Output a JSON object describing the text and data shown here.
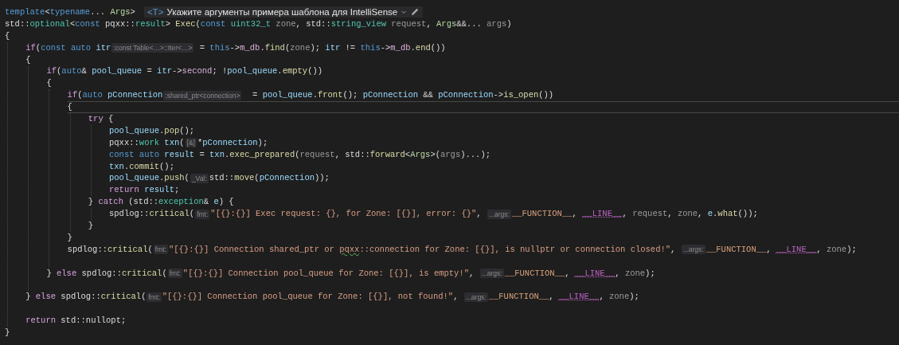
{
  "editor": {
    "lines": [
      {
        "kind": "code",
        "tokens": [
          {
            "text": "template",
            "kind": "kw"
          },
          {
            "text": "<",
            "kind": "pl"
          },
          {
            "text": "typename",
            "kind": "kw"
          },
          {
            "text": "... ",
            "kind": "pl"
          },
          {
            "text": "Args",
            "kind": "tp"
          },
          {
            "text": ">",
            "kind": "pl"
          }
        ],
        "hint_bar": {
          "badge": "<T>",
          "text": "Укажите аргументы примера шаблона для IntelliSense"
        }
      },
      {
        "kind": "code",
        "tokens": [
          {
            "text": "std::",
            "kind": "pl"
          },
          {
            "text": "optional",
            "kind": "type"
          },
          {
            "text": "<",
            "kind": "pl"
          },
          {
            "text": "const",
            "kind": "kw"
          },
          {
            "text": " pqxx::",
            "kind": "pl"
          },
          {
            "text": "result",
            "kind": "type"
          },
          {
            "text": "> ",
            "kind": "pl"
          },
          {
            "text": "Exec",
            "kind": "fn"
          },
          {
            "text": "(",
            "kind": "pl"
          },
          {
            "text": "const ",
            "kind": "kw"
          },
          {
            "text": "uint32_t ",
            "kind": "type"
          },
          {
            "text": "zone",
            "kind": "prm"
          },
          {
            "text": ", std::",
            "kind": "pl"
          },
          {
            "text": "string_view ",
            "kind": "type"
          },
          {
            "text": "request",
            "kind": "prm"
          },
          {
            "text": ", ",
            "kind": "pl"
          },
          {
            "text": "Args",
            "kind": "tp"
          },
          {
            "text": "&&... ",
            "kind": "pl"
          },
          {
            "text": "args",
            "kind": "prm"
          },
          {
            "text": ")",
            "kind": "pl"
          }
        ]
      },
      {
        "kind": "code",
        "tokens": [
          {
            "text": "{",
            "kind": "pl"
          }
        ],
        "children": [
          {
            "kind": "code",
            "tokens": [
              {
                "text": "if",
                "kind": "ctl"
              },
              {
                "text": "(",
                "kind": "pl"
              },
              {
                "text": "const ",
                "kind": "kw"
              },
              {
                "text": "auto ",
                "kind": "kw"
              },
              {
                "text": "itr",
                "kind": "var"
              },
              {
                "text": ":const Table<…>::Iter<…>",
                "kind": "hint"
              },
              {
                "text": " = ",
                "kind": "pl"
              },
              {
                "text": "this",
                "kind": "kw"
              },
              {
                "text": "->",
                "kind": "pl"
              },
              {
                "text": "m_db",
                "kind": "mem"
              },
              {
                "text": ".",
                "kind": "pl"
              },
              {
                "text": "find",
                "kind": "fn"
              },
              {
                "text": "(",
                "kind": "pl"
              },
              {
                "text": "zone",
                "kind": "prm"
              },
              {
                "text": "); ",
                "kind": "pl"
              },
              {
                "text": "itr",
                "kind": "var"
              },
              {
                "text": " != ",
                "kind": "pl"
              },
              {
                "text": "this",
                "kind": "kw"
              },
              {
                "text": "->",
                "kind": "pl"
              },
              {
                "text": "m_db",
                "kind": "mem"
              },
              {
                "text": ".",
                "kind": "pl"
              },
              {
                "text": "end",
                "kind": "fn"
              },
              {
                "text": "())",
                "kind": "pl"
              }
            ]
          },
          {
            "kind": "code",
            "tokens": [
              {
                "text": "{",
                "kind": "pl"
              }
            ],
            "children": [
              {
                "kind": "code",
                "tokens": [
                  {
                    "text": "if",
                    "kind": "ctl"
                  },
                  {
                    "text": "(",
                    "kind": "pl"
                  },
                  {
                    "text": "auto",
                    "kind": "kw"
                  },
                  {
                    "text": "& ",
                    "kind": "pl"
                  },
                  {
                    "text": "pool_queue",
                    "kind": "var"
                  },
                  {
                    "text": " = ",
                    "kind": "pl"
                  },
                  {
                    "text": "itr",
                    "kind": "var"
                  },
                  {
                    "text": "->",
                    "kind": "pl"
                  },
                  {
                    "text": "second",
                    "kind": "mem"
                  },
                  {
                    "text": "; !",
                    "kind": "pl"
                  },
                  {
                    "text": "pool_queue",
                    "kind": "var"
                  },
                  {
                    "text": ".",
                    "kind": "pl"
                  },
                  {
                    "text": "empty",
                    "kind": "fn"
                  },
                  {
                    "text": "())",
                    "kind": "pl"
                  }
                ]
              },
              {
                "kind": "code",
                "tokens": [
                  {
                    "text": "{",
                    "kind": "pl"
                  }
                ],
                "children": [
                  {
                    "kind": "code",
                    "tokens": [
                      {
                        "text": "if",
                        "kind": "ctl"
                      },
                      {
                        "text": "(",
                        "kind": "pl"
                      },
                      {
                        "text": "auto ",
                        "kind": "kw"
                      },
                      {
                        "text": "pConnection",
                        "kind": "var"
                      },
                      {
                        "text": ":shared_ptr<connection>",
                        "kind": "hint"
                      },
                      {
                        "text": "  = ",
                        "kind": "pl"
                      },
                      {
                        "text": "pool_queue",
                        "kind": "var"
                      },
                      {
                        "text": ".",
                        "kind": "pl"
                      },
                      {
                        "text": "front",
                        "kind": "fn"
                      },
                      {
                        "text": "(); ",
                        "kind": "pl"
                      },
                      {
                        "text": "pConnection",
                        "kind": "var"
                      },
                      {
                        "text": " && ",
                        "kind": "pl"
                      },
                      {
                        "text": "pConnection",
                        "kind": "var"
                      },
                      {
                        "text": "->",
                        "kind": "pl"
                      },
                      {
                        "text": "is_open",
                        "kind": "fn"
                      },
                      {
                        "text": "())",
                        "kind": "pl"
                      }
                    ]
                  },
                  {
                    "kind": "code",
                    "current": true,
                    "tokens": [
                      {
                        "text": "{",
                        "kind": "pl"
                      }
                    ],
                    "children": [
                      {
                        "kind": "code",
                        "tokens": [
                          {
                            "text": "try",
                            "kind": "ctl"
                          },
                          {
                            "text": " {",
                            "kind": "pl"
                          }
                        ],
                        "children": [
                          {
                            "kind": "code",
                            "tokens": [
                              {
                                "text": "pool_queue",
                                "kind": "var"
                              },
                              {
                                "text": ".",
                                "kind": "pl"
                              },
                              {
                                "text": "pop",
                                "kind": "fn"
                              },
                              {
                                "text": "();",
                                "kind": "pl"
                              }
                            ]
                          },
                          {
                            "kind": "code",
                            "tokens": [
                              {
                                "text": "pqxx::",
                                "kind": "pl"
                              },
                              {
                                "text": "work ",
                                "kind": "type"
                              },
                              {
                                "text": "txn",
                                "kind": "var"
                              },
                              {
                                "text": "(",
                                "kind": "pl"
                              },
                              {
                                "text": "[&]",
                                "kind": "hint"
                              },
                              {
                                "text": "*",
                                "kind": "pl"
                              },
                              {
                                "text": "pConnection",
                                "kind": "var"
                              },
                              {
                                "text": ");",
                                "kind": "pl"
                              }
                            ]
                          },
                          {
                            "kind": "code",
                            "tokens": [
                              {
                                "text": "const ",
                                "kind": "kw"
                              },
                              {
                                "text": "auto ",
                                "kind": "kw"
                              },
                              {
                                "text": "result",
                                "kind": "var"
                              },
                              {
                                "text": " = ",
                                "kind": "pl"
                              },
                              {
                                "text": "txn",
                                "kind": "var"
                              },
                              {
                                "text": ".",
                                "kind": "pl"
                              },
                              {
                                "text": "exec_prepared",
                                "kind": "fn"
                              },
                              {
                                "text": "(",
                                "kind": "pl"
                              },
                              {
                                "text": "request",
                                "kind": "prm"
                              },
                              {
                                "text": ", std::",
                                "kind": "pl"
                              },
                              {
                                "text": "forward",
                                "kind": "fn"
                              },
                              {
                                "text": "<",
                                "kind": "pl"
                              },
                              {
                                "text": "Args",
                                "kind": "tp"
                              },
                              {
                                "text": ">(",
                                "kind": "pl"
                              },
                              {
                                "text": "args",
                                "kind": "prm"
                              },
                              {
                                "text": ")...);",
                                "kind": "pl"
                              }
                            ]
                          },
                          {
                            "kind": "code",
                            "tokens": [
                              {
                                "text": "txn",
                                "kind": "var"
                              },
                              {
                                "text": ".",
                                "kind": "pl"
                              },
                              {
                                "text": "commit",
                                "kind": "fn"
                              },
                              {
                                "text": "();",
                                "kind": "pl"
                              }
                            ]
                          },
                          {
                            "kind": "code",
                            "tokens": [
                              {
                                "text": "pool_queue",
                                "kind": "var"
                              },
                              {
                                "text": ".",
                                "kind": "pl"
                              },
                              {
                                "text": "push",
                                "kind": "fn"
                              },
                              {
                                "text": "(",
                                "kind": "pl"
                              },
                              {
                                "text": "_Val:",
                                "kind": "hint"
                              },
                              {
                                "text": "std::",
                                "kind": "pl"
                              },
                              {
                                "text": "move",
                                "kind": "fn"
                              },
                              {
                                "text": "(",
                                "kind": "pl"
                              },
                              {
                                "text": "pConnection",
                                "kind": "var"
                              },
                              {
                                "text": "));",
                                "kind": "pl"
                              }
                            ]
                          },
                          {
                            "kind": "code",
                            "tokens": [
                              {
                                "text": "return ",
                                "kind": "ctl"
                              },
                              {
                                "text": "result",
                                "kind": "var"
                              },
                              {
                                "text": ";",
                                "kind": "pl"
                              }
                            ]
                          }
                        ]
                      },
                      {
                        "kind": "code",
                        "tokens": [
                          {
                            "text": "} ",
                            "kind": "pl"
                          },
                          {
                            "text": "catch",
                            "kind": "ctl"
                          },
                          {
                            "text": " (std::",
                            "kind": "pl"
                          },
                          {
                            "text": "exception",
                            "kind": "type"
                          },
                          {
                            "text": "& ",
                            "kind": "pl"
                          },
                          {
                            "text": "e",
                            "kind": "var"
                          },
                          {
                            "text": ") {",
                            "kind": "pl"
                          }
                        ],
                        "children": [
                          {
                            "kind": "code",
                            "tokens": [
                              {
                                "text": "spdlog::",
                                "kind": "pl"
                              },
                              {
                                "text": "critical",
                                "kind": "fn"
                              },
                              {
                                "text": "(",
                                "kind": "pl"
                              },
                              {
                                "text": "fmt:",
                                "kind": "hint"
                              },
                              {
                                "text": "\"[{}:{}] Exec request: {}, for Zone: [{}], error: {}\"",
                                "kind": "str"
                              },
                              {
                                "text": ", ",
                                "kind": "pl"
                              },
                              {
                                "text": "...args:",
                                "kind": "hint"
                              },
                              {
                                "text": "__FUNCTION__",
                                "kind": "ident"
                              },
                              {
                                "text": ", ",
                                "kind": "pl"
                              },
                              {
                                "text": "__LINE__",
                                "kind": "mac"
                              },
                              {
                                "text": ", ",
                                "kind": "pl"
                              },
                              {
                                "text": "request",
                                "kind": "prm"
                              },
                              {
                                "text": ", ",
                                "kind": "pl"
                              },
                              {
                                "text": "zone",
                                "kind": "prm"
                              },
                              {
                                "text": ", ",
                                "kind": "pl"
                              },
                              {
                                "text": "e",
                                "kind": "var"
                              },
                              {
                                "text": ".",
                                "kind": "pl"
                              },
                              {
                                "text": "what",
                                "kind": "fn"
                              },
                              {
                                "text": "());",
                                "kind": "pl"
                              }
                            ]
                          }
                        ]
                      },
                      {
                        "kind": "code",
                        "tokens": [
                          {
                            "text": "}",
                            "kind": "pl"
                          }
                        ]
                      }
                    ]
                  },
                  {
                    "kind": "code",
                    "tokens": [
                      {
                        "text": "}",
                        "kind": "pl"
                      }
                    ]
                  },
                  {
                    "kind": "code",
                    "tokens": [
                      {
                        "text": "spdlog::",
                        "kind": "pl"
                      },
                      {
                        "text": "critical",
                        "kind": "fn"
                      },
                      {
                        "text": "(",
                        "kind": "pl"
                      },
                      {
                        "text": "fmt:",
                        "kind": "hint"
                      },
                      {
                        "text": "\"[{}:{}] Connection shared_ptr or ",
                        "kind": "str"
                      },
                      {
                        "text": "pqxx",
                        "kind": "str",
                        "squiggle": true
                      },
                      {
                        "text": "::connection for Zone: [{}], is nullptr or connection closed!\"",
                        "kind": "str"
                      },
                      {
                        "text": ", ",
                        "kind": "pl"
                      },
                      {
                        "text": "...args:",
                        "kind": "hint"
                      },
                      {
                        "text": "__FUNCTION__",
                        "kind": "ident"
                      },
                      {
                        "text": ", ",
                        "kind": "pl"
                      },
                      {
                        "text": "__LINE__",
                        "kind": "mac"
                      },
                      {
                        "text": ", ",
                        "kind": "pl"
                      },
                      {
                        "text": "zone",
                        "kind": "prm"
                      },
                      {
                        "text": ");",
                        "kind": "pl"
                      }
                    ]
                  },
                  {
                    "kind": "blank"
                  }
                ]
              },
              {
                "kind": "code",
                "tokens": [
                  {
                    "text": "} ",
                    "kind": "pl"
                  },
                  {
                    "text": "else",
                    "kind": "ctl"
                  },
                  {
                    "text": " spdlog::",
                    "kind": "pl"
                  },
                  {
                    "text": "critical",
                    "kind": "fn"
                  },
                  {
                    "text": "(",
                    "kind": "pl"
                  },
                  {
                    "text": "fmt:",
                    "kind": "hint"
                  },
                  {
                    "text": "\"[{}:{}] Connection pool_queue for Zone: [{}], is empty!\"",
                    "kind": "str"
                  },
                  {
                    "text": ", ",
                    "kind": "pl"
                  },
                  {
                    "text": "...args:",
                    "kind": "hint"
                  },
                  {
                    "text": "__FUNCTION__",
                    "kind": "ident"
                  },
                  {
                    "text": ", ",
                    "kind": "pl"
                  },
                  {
                    "text": "__LINE__",
                    "kind": "mac"
                  },
                  {
                    "text": ", ",
                    "kind": "pl"
                  },
                  {
                    "text": "zone",
                    "kind": "prm"
                  },
                  {
                    "text": ");",
                    "kind": "pl"
                  }
                ]
              },
              {
                "kind": "blank"
              }
            ]
          },
          {
            "kind": "code",
            "tokens": [
              {
                "text": "} ",
                "kind": "pl"
              },
              {
                "text": "else",
                "kind": "ctl"
              },
              {
                "text": " spdlog::",
                "kind": "pl"
              },
              {
                "text": "critical",
                "kind": "fn"
              },
              {
                "text": "(",
                "kind": "pl"
              },
              {
                "text": "fmt:",
                "kind": "hint"
              },
              {
                "text": "\"[{}:{}] Connection pool_queue for Zone: [{}], not found!\"",
                "kind": "str"
              },
              {
                "text": ", ",
                "kind": "pl"
              },
              {
                "text": "...args:",
                "kind": "hint"
              },
              {
                "text": "__FUNCTION__",
                "kind": "ident"
              },
              {
                "text": ", ",
                "kind": "pl"
              },
              {
                "text": "__LINE__",
                "kind": "mac"
              },
              {
                "text": ", ",
                "kind": "pl"
              },
              {
                "text": "zone",
                "kind": "prm"
              },
              {
                "text": ");",
                "kind": "pl"
              }
            ]
          },
          {
            "kind": "blank"
          },
          {
            "kind": "code",
            "tokens": [
              {
                "text": "return",
                "kind": "ctl"
              },
              {
                "text": " std::",
                "kind": "pl"
              },
              {
                "text": "nullopt",
                "kind": "pl"
              },
              {
                "text": ";",
                "kind": "pl"
              }
            ]
          }
        ]
      },
      {
        "kind": "code",
        "tokens": [
          {
            "text": "}",
            "kind": "pl"
          }
        ]
      }
    ]
  }
}
